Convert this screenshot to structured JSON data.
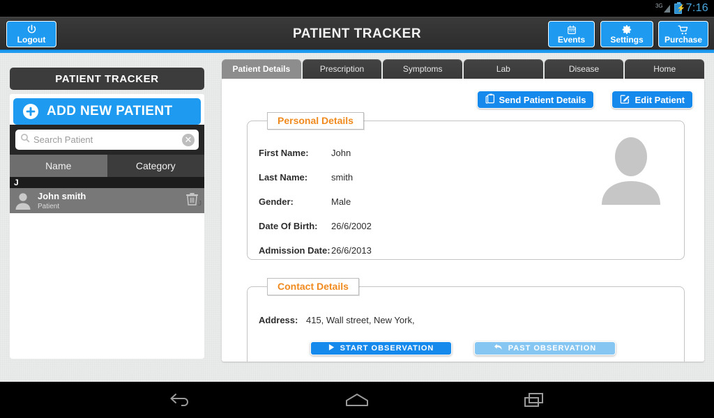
{
  "statusbar": {
    "network": "3G",
    "time": "7:16",
    "network_icon": "signal-3g-icon",
    "battery_icon": "battery-charging-icon"
  },
  "header": {
    "title": "PATIENT TRACKER",
    "logout": {
      "label": "Logout",
      "icon": "power-icon"
    },
    "events": {
      "label": "Events",
      "icon": "calendar-icon"
    },
    "settings": {
      "label": "Settings",
      "icon": "gear-icon"
    },
    "purchase": {
      "label": "Purchase",
      "icon": "shopping-cart-icon"
    },
    "accent_color": "#1e9bf0"
  },
  "sidebar": {
    "title": "PATIENT TRACKER",
    "add_button": {
      "label": "ADD NEW PATIENT",
      "icon": "plus-circle-icon"
    },
    "search": {
      "placeholder": "Search Patient",
      "value": "",
      "icon": "search-icon",
      "clear_icon": "clear-x-icon"
    },
    "segments": [
      {
        "label": "Name",
        "selected": true
      },
      {
        "label": "Category",
        "selected": false
      }
    ],
    "index_letter": "J",
    "fast_index_letter": "J",
    "patients": [
      {
        "name": "John smith",
        "category": "Patient",
        "avatar_icon": "person-avatar-icon",
        "delete_icon": "trash-icon",
        "selected": true
      }
    ]
  },
  "main": {
    "tabs": [
      {
        "label": "Patient Details",
        "active": true
      },
      {
        "label": "Prescription",
        "active": false
      },
      {
        "label": "Symptoms",
        "active": false
      },
      {
        "label": "Lab",
        "active": false
      },
      {
        "label": "Disease",
        "active": false
      },
      {
        "label": "Home",
        "active": false
      }
    ],
    "actions": [
      {
        "label": "Send Patient Details",
        "icon": "clipboard-icon"
      },
      {
        "label": "Edit Patient",
        "icon": "edit-pencil-icon"
      }
    ],
    "personal_details": {
      "legend": "Personal Details",
      "legend_color": "#f08a1e",
      "avatar_icon": "person-placeholder-icon",
      "fields": [
        {
          "key": "First Name:",
          "value": "John"
        },
        {
          "key": "Last Name:",
          "value": "smith"
        },
        {
          "key": "Gender:",
          "value": "Male"
        },
        {
          "key": "Date Of Birth:",
          "value": "26/6/2002"
        },
        {
          "key": "Admission Date:",
          "value": "26/6/2013"
        }
      ]
    },
    "contact_details": {
      "legend": "Contact Details",
      "legend_color": "#f08a1e",
      "fields": [
        {
          "key": "Address:",
          "value": "415, Wall street, New York,"
        }
      ]
    },
    "observation_buttons": [
      {
        "label": "START OBSERVATION",
        "icon": "play-icon"
      },
      {
        "label": "PAST OBSERVATION",
        "icon": "back-arrow-icon"
      }
    ]
  },
  "navbar": {
    "back": "back-icon",
    "home": "home-icon",
    "recents": "recents-icon"
  }
}
